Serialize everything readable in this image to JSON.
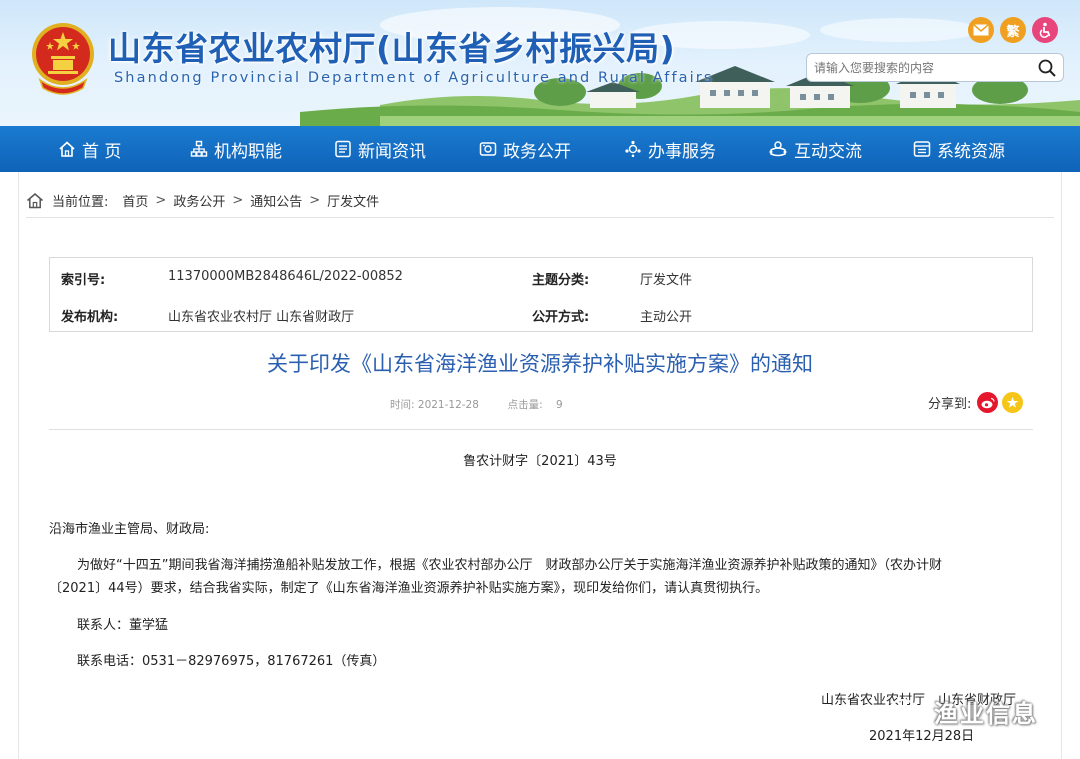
{
  "header": {
    "title": "山东省农业农村厅(山东省乡村振兴局)",
    "subtitle": "Shandong Provincial Department of Agriculture and Rural Affairs",
    "search_placeholder": "请输入您要搜索的内容",
    "icons": [
      "mail-icon",
      "traditional-chinese-icon",
      "accessibility-icon"
    ],
    "trad_label": "繁"
  },
  "nav": {
    "items": [
      {
        "label": "首 页",
        "icon": "home-icon"
      },
      {
        "label": "机构职能",
        "icon": "org-icon"
      },
      {
        "label": "新闻资讯",
        "icon": "news-icon"
      },
      {
        "label": "政务公开",
        "icon": "gov-icon"
      },
      {
        "label": "办事服务",
        "icon": "service-icon"
      },
      {
        "label": "互动交流",
        "icon": "interact-icon"
      },
      {
        "label": "系统资源",
        "icon": "resource-icon"
      }
    ]
  },
  "breadcrumb": {
    "prefix": "当前位置:",
    "items": [
      "首页",
      "政务公开",
      "通知公告",
      "厅发文件"
    ],
    "separator": ">"
  },
  "info": {
    "index_label": "索引号:",
    "index_value": "11370000MB2848646L/2022-00852",
    "topic_label": "主题分类:",
    "topic_value": "厅发文件",
    "publisher_label": "发布机构:",
    "publisher_value": "山东省农业农村厅 山东省财政厅",
    "disclosure_label": "公开方式:",
    "disclosure_value": "主动公开"
  },
  "article": {
    "title": "关于印发《山东省海洋渔业资源养护补贴实施方案》的通知",
    "time_label": "时间:",
    "time_value": "2021-12-28",
    "hits_label": "点击量:",
    "hits_value": "9",
    "share_label": "分享到:",
    "doc_number": "鲁农计财字〔2021〕43号",
    "salutation": "沿海市渔业主管局、财政局:",
    "body_line1": "为做好“十四五”期间我省海洋捕捞渔船补贴发放工作，根据《农业农村部办公厅　财政部办公厅关于实施海洋渔业资源养护补贴政策的通知》（农办计财",
    "body_line2": "〔2021〕44号）要求，结合我省实际，制定了《山东省海洋渔业资源养护补贴实施方案》，现印发给你们，请认真贯彻执行。",
    "contact_person": "联系人：董学猛",
    "contact_phone": "联系电话：0531－82976975，81767261（传真）",
    "sign_org": "山东省农业农村厅　山东省财政厅",
    "sign_date": "2021年12月28日"
  },
  "watermark": "渔业信息",
  "colors": {
    "nav_blue": "#0f63b8",
    "title_blue": "#2b5fb0",
    "mail_orange": "#f0a020",
    "trad_orange": "#f0a020",
    "access_pink": "#e8457c",
    "weibo_red": "#e6162d",
    "star_yellow": "#f5c518"
  }
}
